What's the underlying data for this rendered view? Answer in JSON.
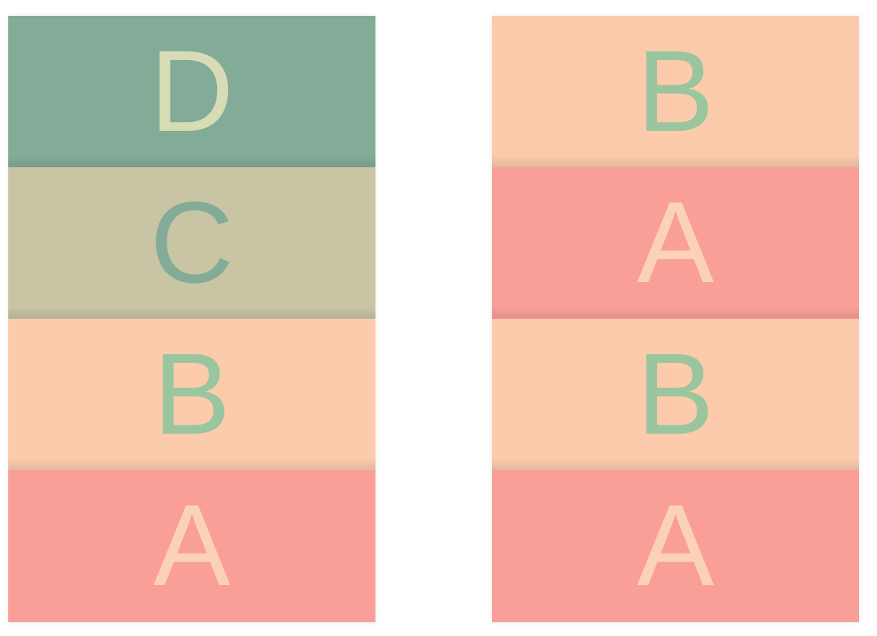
{
  "stacks": [
    {
      "id": "left",
      "blocks": [
        {
          "label": "D",
          "bg": "#83ac98",
          "fg": "#d7dcb6"
        },
        {
          "label": "C",
          "bg": "#c9c4a4",
          "fg": "#83ac98"
        },
        {
          "label": "B",
          "bg": "#fbcbac",
          "fg": "#99c59f"
        },
        {
          "label": "A",
          "bg": "#f99f98",
          "fg": "#fbd2b6"
        }
      ]
    },
    {
      "id": "right",
      "blocks": [
        {
          "label": "B",
          "bg": "#fbcbac",
          "fg": "#99c59f"
        },
        {
          "label": "A",
          "bg": "#f99f98",
          "fg": "#fbd2b6"
        },
        {
          "label": "B",
          "bg": "#fbcbac",
          "fg": "#99c59f"
        },
        {
          "label": "A",
          "bg": "#f99f98",
          "fg": "#fbd2b6"
        }
      ]
    }
  ]
}
